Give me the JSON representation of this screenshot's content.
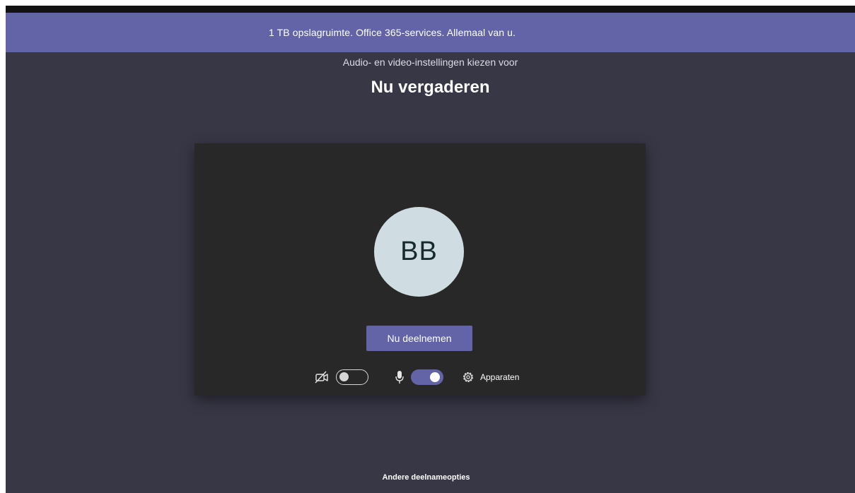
{
  "banner": {
    "text": "1 TB opslagruimte. Office 365-services. Allemaal van u."
  },
  "header": {
    "subtitle": "Audio- en video-instellingen kiezen voor",
    "title": "Nu vergaderen"
  },
  "preview": {
    "avatar_initials": "BB",
    "join_label": "Nu deelnemen"
  },
  "controls": {
    "camera_icon": "camera-off-icon",
    "camera_enabled": false,
    "mic_icon": "microphone-icon",
    "mic_enabled": true,
    "devices_icon": "gear-icon",
    "devices_label": "Apparaten"
  },
  "footer": {
    "other_options_label": "Andere deelnameopties"
  },
  "colors": {
    "accent": "#6264a7",
    "background": "#383746",
    "card": "#292828",
    "avatar_bg": "#cfdde2"
  }
}
